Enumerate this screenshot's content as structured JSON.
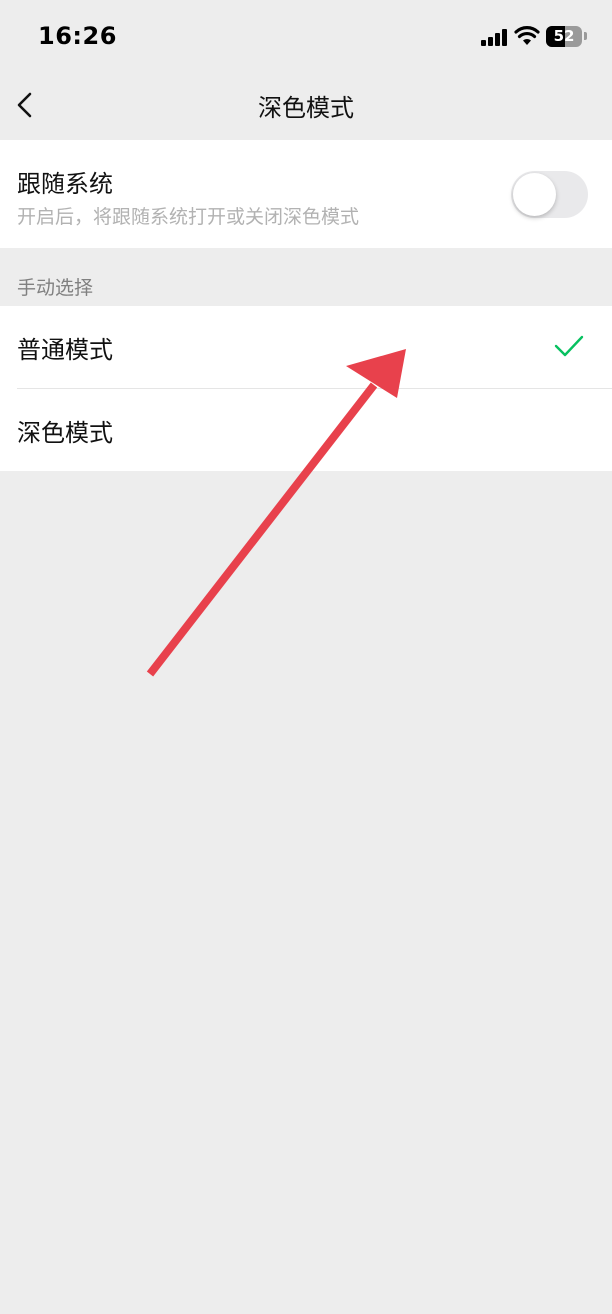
{
  "status_bar": {
    "time": "16:26",
    "battery_level": "52",
    "icons": [
      "signal-icon",
      "wifi-icon",
      "battery-icon"
    ]
  },
  "nav": {
    "back_icon": "chevron-left-icon",
    "title": "深色模式"
  },
  "follow_system": {
    "title": "跟随系统",
    "description": "开启后，将跟随系统打开或关闭深色模式",
    "enabled": false
  },
  "manual": {
    "section_title": "手动选择",
    "options": [
      {
        "label": "普通模式",
        "selected": true
      },
      {
        "label": "深色模式",
        "selected": false
      }
    ]
  },
  "colors": {
    "background": "#ededed",
    "card": "#ffffff",
    "check": "#07c160",
    "annotation_arrow": "#e8414c"
  }
}
